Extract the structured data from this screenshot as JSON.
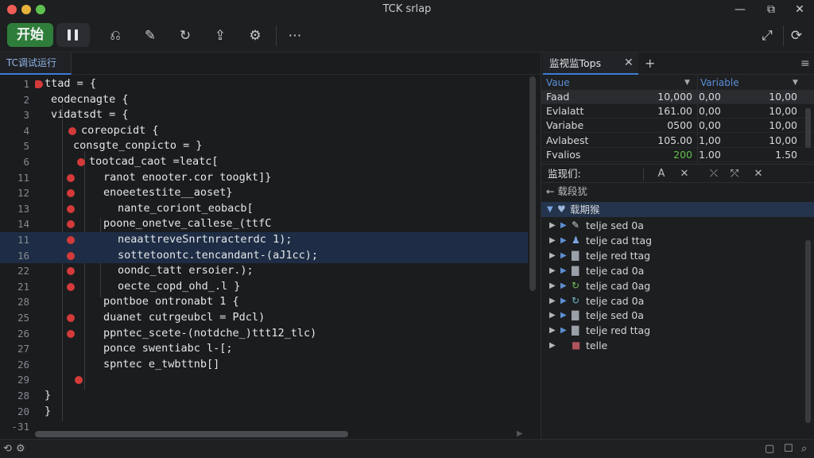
{
  "window": {
    "title": "TCK srlap"
  },
  "toolbar": {
    "start_label": "开始"
  },
  "editor": {
    "tab_label": "TC调试运行",
    "lines": [
      {
        "ln": "1",
        "code": "ttad = {",
        "indent": 56,
        "bp": "tab",
        "hl": false
      },
      {
        "ln": "2",
        "code": "eodecnagte {",
        "indent": 64,
        "bp": "",
        "hl": false
      },
      {
        "ln": "3",
        "code": "vidatsdt = {",
        "indent": 64,
        "bp": "",
        "hl": false
      },
      {
        "ln": "4",
        "code": "coreopcidt {",
        "indent": 102,
        "bp": "dot",
        "hl": false
      },
      {
        "ln": "5",
        "code": "consgte_conpicto = }",
        "indent": 92,
        "bp": "",
        "hl": false
      },
      {
        "ln": "6",
        "code": "tootcad_caot =leatc[",
        "indent": 112,
        "bp": "dot",
        "hl": false
      },
      {
        "ln": "11",
        "code": "ranot enooter.cor toogkt]}",
        "indent": 130,
        "bp": "dot",
        "hl": false
      },
      {
        "ln": "12",
        "code": "enoeetestite__aoset}",
        "indent": 130,
        "bp": "dot",
        "hl": false
      },
      {
        "ln": "13",
        "code": "nante_coriont_eobacb[",
        "indent": 148,
        "bp": "dot",
        "hl": false
      },
      {
        "ln": "14",
        "code": "poone_onetve_callese_(ttfC",
        "indent": 130,
        "bp": "dot",
        "hl": false
      },
      {
        "ln": "11",
        "code": "neaattreveSnrtnracterdc 1);",
        "indent": 148,
        "bp": "dot",
        "hl": true
      },
      {
        "ln": "16",
        "code": "sottetoontc.tencandant-(aJ1cc);",
        "indent": 148,
        "bp": "dot",
        "hl": true
      },
      {
        "ln": "22",
        "code": "oondc_tatt ersoier.);",
        "indent": 148,
        "bp": "dot",
        "hl": false
      },
      {
        "ln": "21",
        "code": "oecte_copd_ohd_.l }",
        "indent": 148,
        "bp": "dot",
        "hl": false
      },
      {
        "ln": "28",
        "code": "pontboe ontronabt 1 {",
        "indent": 130,
        "bp": "",
        "hl": false
      },
      {
        "ln": "25",
        "code": "duanet cutrgeubcl = Pdcl)",
        "indent": 130,
        "bp": "dot",
        "hl": false
      },
      {
        "ln": "26",
        "code": "ppntec_scete-(notdche_)ttt12_tlc)",
        "indent": 130,
        "bp": "dot",
        "hl": false
      },
      {
        "ln": "27",
        "code": "ponce swentiabc l-[;",
        "indent": 130,
        "bp": "",
        "hl": false
      },
      {
        "ln": "26",
        "code": "spntec e_twbttnb[]",
        "indent": 130,
        "bp": "",
        "hl": false
      },
      {
        "ln": "29",
        "code": "",
        "indent": 130,
        "bp": "dot",
        "hl": false
      },
      {
        "ln": "28",
        "code": "}",
        "indent": 56,
        "bp": "",
        "hl": false
      },
      {
        "ln": "20",
        "code": "}",
        "indent": 56,
        "bp": "",
        "hl": false
      },
      {
        "ln": "-31",
        "code": "",
        "indent": 56,
        "bp": "",
        "hl": false
      }
    ]
  },
  "watch": {
    "tab_label": "监视监Tops",
    "col1_header": "Vaue",
    "col2_header": "Variable",
    "rows": [
      {
        "name": "Faad",
        "v1": "10,000",
        "v2": "0,00",
        "v3": "10,00",
        "green": false,
        "sel": true
      },
      {
        "name": "Evlalatt",
        "v1": "161.00",
        "v2": "0,00",
        "v3": "10,00",
        "green": false,
        "sel": false
      },
      {
        "name": "Variabe",
        "v1": "0500",
        "v2": "0,00",
        "v3": "10,00",
        "green": false,
        "sel": false
      },
      {
        "name": "Avlabest",
        "v1": "105.00",
        "v2": "1,00",
        "v3": "10,00",
        "green": false,
        "sel": false
      },
      {
        "name": "Fvalios",
        "v1": "200",
        "v2": "1.00",
        "v3": "1.50",
        "green": true,
        "sel": false
      }
    ]
  },
  "monitor": {
    "title": "监现们:",
    "parent_label": "← 载段犹",
    "group_label": "载期猴",
    "items": [
      {
        "label": "telje sed 0a",
        "icon": "pencil-icon",
        "glyph": "✎",
        "color": "#cfd2d6"
      },
      {
        "label": "telje cad ttag",
        "icon": "person-icon",
        "glyph": "♟",
        "color": "#7aa6e0"
      },
      {
        "label": "telje red ttag",
        "icon": "file-icon",
        "glyph": "▇",
        "color": "#9aa0a8"
      },
      {
        "label": "telje cad 0a",
        "icon": "file-icon",
        "glyph": "▇",
        "color": "#9aa0a8"
      },
      {
        "label": "telje cad 0ag",
        "icon": "refresh-icon",
        "glyph": "↻",
        "color": "#6fbf5a"
      },
      {
        "label": "telje cad 0a",
        "icon": "refresh-icon",
        "glyph": "↻",
        "color": "#6fb7c9"
      },
      {
        "label": "telje sed 0a",
        "icon": "file-icon",
        "glyph": "▇",
        "color": "#9aa0a8"
      },
      {
        "label": "telje red ttag",
        "icon": "file-icon",
        "glyph": "▇",
        "color": "#9aa0a8"
      }
    ],
    "last_label": "telle"
  }
}
